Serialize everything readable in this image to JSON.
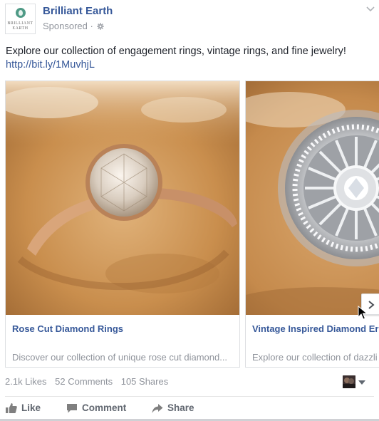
{
  "post": {
    "page_name": "Brilliant Earth",
    "sponsored_label": "Sponsored",
    "logo_line1": "BRILLIANT",
    "logo_line2": "EARTH",
    "message": "Explore our collection of engagement rings, vintage rings, and fine jewelry!",
    "link": "http://bit.ly/1MuvhjL"
  },
  "carousel": {
    "cards": [
      {
        "headline": "Rose Cut Diamond Rings",
        "description": "Discover our collection of unique rose cut diamond...",
        "image": "rose-gold-rose-cut-diamond-ring"
      },
      {
        "headline": "Vintage Inspired Diamond Er",
        "description": "Explore our collection of dazzli",
        "image": "vintage-halo-diamond-ring"
      }
    ]
  },
  "stats": {
    "likes": "2.1k Likes",
    "comments": "52 Comments",
    "shares": "105 Shares"
  },
  "actions": {
    "like_label": "Like",
    "comment_label": "Comment",
    "share_label": "Share"
  },
  "colors": {
    "link_blue": "#365899",
    "muted_gray": "#90949c",
    "action_gray": "#616770",
    "logo_green": "#4f9a86"
  }
}
